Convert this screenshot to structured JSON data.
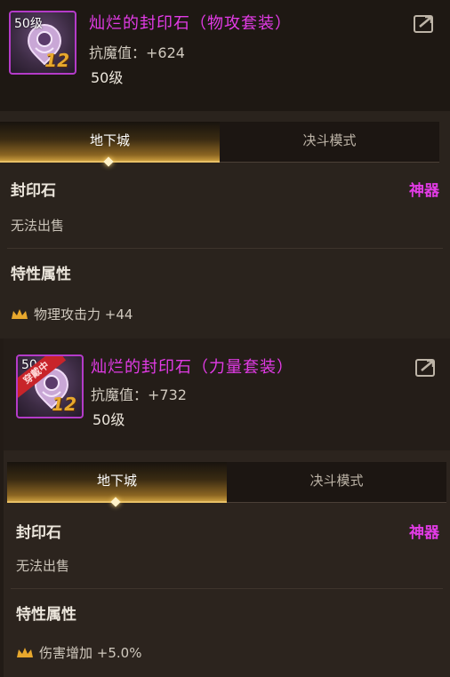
{
  "cards": [
    {
      "level_badge": "50级",
      "wearing_badge": "",
      "refine": "12",
      "title": "灿烂的封印石（物攻套装）",
      "stat": "抗魔值：+624",
      "level": "50级",
      "tabs": {
        "active": "地下城",
        "inactive": "决斗模式"
      },
      "item_type": "封印石",
      "rarity": "神器",
      "sell_text": "无法出售",
      "traits_title": "特性属性",
      "trait": "物理攻击力 +44"
    },
    {
      "level_badge": "50",
      "wearing_badge": "穿戴中",
      "refine": "12",
      "title": "灿烂的封印石（力量套装）",
      "stat": "抗魔值：+732",
      "level": "50级",
      "tabs": {
        "active": "地下城",
        "inactive": "决斗模式"
      },
      "item_type": "封印石",
      "rarity": "神器",
      "sell_text": "无法出售",
      "traits_title": "特性属性",
      "trait": "伤害增加 +5.0%"
    }
  ],
  "colors": {
    "title_purple": "#e23be6",
    "tab_gold": "#c79a3d",
    "crown_gold": "#e8a82d",
    "wearing_red": "#c8242a"
  },
  "icons": [
    "seal-stone-icon",
    "share-icon",
    "crown-icon"
  ]
}
